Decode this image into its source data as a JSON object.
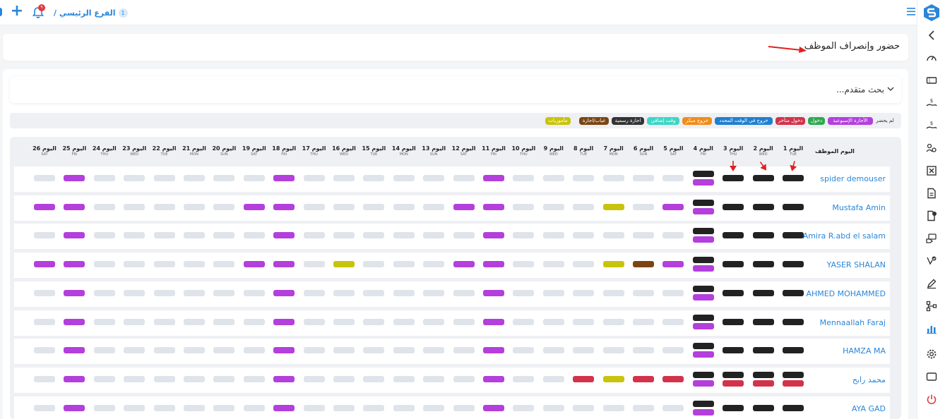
{
  "topbar": {
    "branch_label": "الفرع الرئيسي /",
    "branch_number": "1",
    "notification_count": "٩"
  },
  "page": {
    "title": "حضور وإنصراف الموظف"
  },
  "search": {
    "advanced_label": "بحث متقدم..."
  },
  "colors": {
    "absent": "#dfe3ea",
    "present": "#222222",
    "weekly_off": "#b33fdc",
    "late_in": "#d2334a",
    "early_out": "#f08c1a",
    "on_time_out": "#1f7fd0",
    "overtime": "#3cd6c7",
    "official_holiday": "#333333",
    "leave_absence": "#7a4512",
    "missions": "#c9c30d",
    "present_green": "#2fa84f"
  },
  "legend": [
    {
      "key": "absent",
      "label": "لم يحضر",
      "color": "#eef0f3",
      "plain": true
    },
    {
      "key": "weekly_off",
      "label": "الأجازة الإسبوعية",
      "color": "#b33fdc"
    },
    {
      "key": "present_green",
      "label": "دخول",
      "color": "#2fa84f"
    },
    {
      "key": "late_in",
      "label": "دخول متأخر",
      "color": "#d2334a"
    },
    {
      "key": "on_time_out",
      "label": "خروج في الوقت المحدد",
      "color": "#1f7fd0"
    },
    {
      "key": "early_out",
      "label": "خروج مبكر",
      "color": "#f08c1a"
    },
    {
      "key": "overtime",
      "label": "وقت إضافي",
      "color": "#3cd6c7"
    },
    {
      "key": "official_holiday",
      "label": "اجازة رسمية",
      "color": "#333333"
    },
    {
      "key": "leave_absence",
      "label": "غياب/اجازة",
      "color": "#7a4512"
    },
    {
      "key": "missions",
      "label": "مأموريات",
      "color": "#c9c30d"
    }
  ],
  "grid": {
    "employee_header": "اليوم الموظف",
    "days": [
      {
        "label": "اليوم 1",
        "weekday": "TUE"
      },
      {
        "label": "اليوم 2",
        "weekday": "WED"
      },
      {
        "label": "اليوم 3",
        "weekday": "THU"
      },
      {
        "label": "اليوم 4",
        "weekday": "FRI"
      },
      {
        "label": "اليوم 5",
        "weekday": "SAT"
      },
      {
        "label": "اليوم 6",
        "weekday": "SUN"
      },
      {
        "label": "اليوم 7",
        "weekday": "MON"
      },
      {
        "label": "اليوم 8",
        "weekday": "TUE"
      },
      {
        "label": "اليوم 9",
        "weekday": "WED"
      },
      {
        "label": "اليوم 10",
        "weekday": "THU"
      },
      {
        "label": "اليوم 11",
        "weekday": "FRI"
      },
      {
        "label": "اليوم 12",
        "weekday": "SAT"
      },
      {
        "label": "اليوم 13",
        "weekday": "SUN"
      },
      {
        "label": "اليوم 14",
        "weekday": "MON"
      },
      {
        "label": "اليوم 15",
        "weekday": "TUE"
      },
      {
        "label": "اليوم 16",
        "weekday": "WED"
      },
      {
        "label": "اليوم 17",
        "weekday": "THU"
      },
      {
        "label": "اليوم 18",
        "weekday": "FRI"
      },
      {
        "label": "اليوم 19",
        "weekday": "SAT"
      },
      {
        "label": "اليوم 20",
        "weekday": "SUN"
      },
      {
        "label": "اليوم 21",
        "weekday": "MON"
      },
      {
        "label": "اليوم 22",
        "weekday": "TUE"
      },
      {
        "label": "اليوم 23",
        "weekday": "WED"
      },
      {
        "label": "اليوم 24",
        "weekday": "THU"
      },
      {
        "label": "اليوم 25",
        "weekday": "FRI"
      },
      {
        "label": "اليوم 26",
        "weekday": "SAT"
      }
    ],
    "employees": [
      {
        "name": "spider demouser",
        "cells": [
          [
            "K"
          ],
          [
            "K"
          ],
          [
            "K"
          ],
          [
            "K",
            "P"
          ],
          [
            "A"
          ],
          [
            "A"
          ],
          [
            "A"
          ],
          [
            "A"
          ],
          [
            "A"
          ],
          [
            "A"
          ],
          [
            "P"
          ],
          [
            "A"
          ],
          [
            "A"
          ],
          [
            "A"
          ],
          [
            "A"
          ],
          [
            "A"
          ],
          [
            "A"
          ],
          [
            "P"
          ],
          [
            "A"
          ],
          [
            "A"
          ],
          [
            "A"
          ],
          [
            "A"
          ],
          [
            "A"
          ],
          [
            "A"
          ],
          [
            "P"
          ],
          [
            "A"
          ]
        ]
      },
      {
        "name": "Mustafa Amin",
        "cells": [
          [
            "K"
          ],
          [
            "K"
          ],
          [
            "K"
          ],
          [
            "K",
            "P"
          ],
          [
            "P"
          ],
          [
            "A"
          ],
          [
            "Y"
          ],
          [
            "A"
          ],
          [
            "A"
          ],
          [
            "A"
          ],
          [
            "P"
          ],
          [
            "P"
          ],
          [
            "A"
          ],
          [
            "A"
          ],
          [
            "A"
          ],
          [
            "A"
          ],
          [
            "A"
          ],
          [
            "P"
          ],
          [
            "P"
          ],
          [
            "A"
          ],
          [
            "A"
          ],
          [
            "A"
          ],
          [
            "A"
          ],
          [
            "A"
          ],
          [
            "P"
          ],
          [
            "P"
          ]
        ]
      },
      {
        "name": "Amira R.abd el salam",
        "cells": [
          [
            "K"
          ],
          [
            "K"
          ],
          [
            "K"
          ],
          [
            "K",
            "P"
          ],
          [
            "A"
          ],
          [
            "A"
          ],
          [
            "A"
          ],
          [
            "A"
          ],
          [
            "A"
          ],
          [
            "A"
          ],
          [
            "P"
          ],
          [
            "A"
          ],
          [
            "A"
          ],
          [
            "A"
          ],
          [
            "A"
          ],
          [
            "A"
          ],
          [
            "A"
          ],
          [
            "P"
          ],
          [
            "A"
          ],
          [
            "A"
          ],
          [
            "A"
          ],
          [
            "A"
          ],
          [
            "A"
          ],
          [
            "A"
          ],
          [
            "P"
          ],
          [
            "A"
          ]
        ]
      },
      {
        "name": "YASER SHALAN",
        "cells": [
          [
            "K"
          ],
          [
            "K"
          ],
          [
            "K"
          ],
          [
            "K",
            "P"
          ],
          [
            "P"
          ],
          [
            "B"
          ],
          [
            "Y"
          ],
          [
            "A"
          ],
          [
            "A"
          ],
          [
            "A"
          ],
          [
            "P"
          ],
          [
            "P"
          ],
          [
            "A"
          ],
          [
            "A"
          ],
          [
            "A"
          ],
          [
            "Y"
          ],
          [
            "A"
          ],
          [
            "P"
          ],
          [
            "P"
          ],
          [
            "A"
          ],
          [
            "A"
          ],
          [
            "A"
          ],
          [
            "A"
          ],
          [
            "A"
          ],
          [
            "P"
          ],
          [
            "P"
          ]
        ]
      },
      {
        "name": "AHMED MOHAMMED",
        "cells": [
          [
            "K"
          ],
          [
            "K"
          ],
          [
            "K"
          ],
          [
            "K",
            "P"
          ],
          [
            "A"
          ],
          [
            "A"
          ],
          [
            "A"
          ],
          [
            "A"
          ],
          [
            "A"
          ],
          [
            "A"
          ],
          [
            "P"
          ],
          [
            "A"
          ],
          [
            "A"
          ],
          [
            "A"
          ],
          [
            "A"
          ],
          [
            "A"
          ],
          [
            "A"
          ],
          [
            "P"
          ],
          [
            "A"
          ],
          [
            "A"
          ],
          [
            "A"
          ],
          [
            "A"
          ],
          [
            "A"
          ],
          [
            "A"
          ],
          [
            "P"
          ],
          [
            "A"
          ]
        ]
      },
      {
        "name": "Mennaallah Faraj",
        "cells": [
          [
            "K"
          ],
          [
            "K"
          ],
          [
            "K"
          ],
          [
            "K",
            "P"
          ],
          [
            "A"
          ],
          [
            "A"
          ],
          [
            "A"
          ],
          [
            "A"
          ],
          [
            "A"
          ],
          [
            "A"
          ],
          [
            "P"
          ],
          [
            "A"
          ],
          [
            "A"
          ],
          [
            "A"
          ],
          [
            "A"
          ],
          [
            "A"
          ],
          [
            "A"
          ],
          [
            "P"
          ],
          [
            "A"
          ],
          [
            "A"
          ],
          [
            "A"
          ],
          [
            "A"
          ],
          [
            "A"
          ],
          [
            "A"
          ],
          [
            "P"
          ],
          [
            "A"
          ]
        ]
      },
      {
        "name": "HAMZA MA",
        "cells": [
          [
            "K"
          ],
          [
            "K"
          ],
          [
            "K"
          ],
          [
            "K",
            "P"
          ],
          [
            "A"
          ],
          [
            "A"
          ],
          [
            "A"
          ],
          [
            "A"
          ],
          [
            "A"
          ],
          [
            "A"
          ],
          [
            "P"
          ],
          [
            "A"
          ],
          [
            "A"
          ],
          [
            "A"
          ],
          [
            "A"
          ],
          [
            "A"
          ],
          [
            "A"
          ],
          [
            "P"
          ],
          [
            "A"
          ],
          [
            "A"
          ],
          [
            "A"
          ],
          [
            "A"
          ],
          [
            "A"
          ],
          [
            "A"
          ],
          [
            "P"
          ],
          [
            "A"
          ]
        ]
      },
      {
        "name": "محمد رابح",
        "cells": [
          [
            "K",
            "R"
          ],
          [
            "K",
            "R"
          ],
          [
            "K",
            "R"
          ],
          [
            "K",
            "P"
          ],
          [
            "R"
          ],
          [
            "R"
          ],
          [
            "Y"
          ],
          [
            "R"
          ],
          [
            "A"
          ],
          [
            "A"
          ],
          [
            "P"
          ],
          [
            "A"
          ],
          [
            "A"
          ],
          [
            "A"
          ],
          [
            "A"
          ],
          [
            "A"
          ],
          [
            "A"
          ],
          [
            "P"
          ],
          [
            "A"
          ],
          [
            "A"
          ],
          [
            "A"
          ],
          [
            "A"
          ],
          [
            "A"
          ],
          [
            "A"
          ],
          [
            "P"
          ],
          [
            "A"
          ]
        ]
      },
      {
        "name": "AYA GAD",
        "cells": [
          [
            "K"
          ],
          [
            "K"
          ],
          [
            "K"
          ],
          [
            "K",
            "P"
          ],
          [
            "A"
          ],
          [
            "A"
          ],
          [
            "A"
          ],
          [
            "A"
          ],
          [
            "A"
          ],
          [
            "A"
          ],
          [
            "P"
          ],
          [
            "A"
          ],
          [
            "A"
          ],
          [
            "A"
          ],
          [
            "A"
          ],
          [
            "A"
          ],
          [
            "A"
          ],
          [
            "P"
          ],
          [
            "A"
          ],
          [
            "A"
          ],
          [
            "A"
          ],
          [
            "A"
          ],
          [
            "A"
          ],
          [
            "A"
          ],
          [
            "P"
          ],
          [
            "A"
          ]
        ]
      }
    ]
  },
  "cell_codes": {
    "A": "#dfe3ea",
    "K": "#222222",
    "P": "#b33fdc",
    "R": "#d2334a",
    "Y": "#c9c30d",
    "B": "#7a4512"
  },
  "sidebar": {
    "icons": [
      "chevron-left-icon",
      "dashboard-gauge-icon",
      "ticket-icon",
      "money-hand-icon",
      "money-hand-icon",
      "users-gear-icon",
      "cancel-box-icon",
      "document-icon",
      "file-star-icon",
      "card-hand-icon",
      "check-badge-icon",
      "pen-icon",
      "hierarchy-icon",
      "bar-chart-icon",
      "gear-icon",
      "window-icon",
      "power-icon"
    ]
  }
}
